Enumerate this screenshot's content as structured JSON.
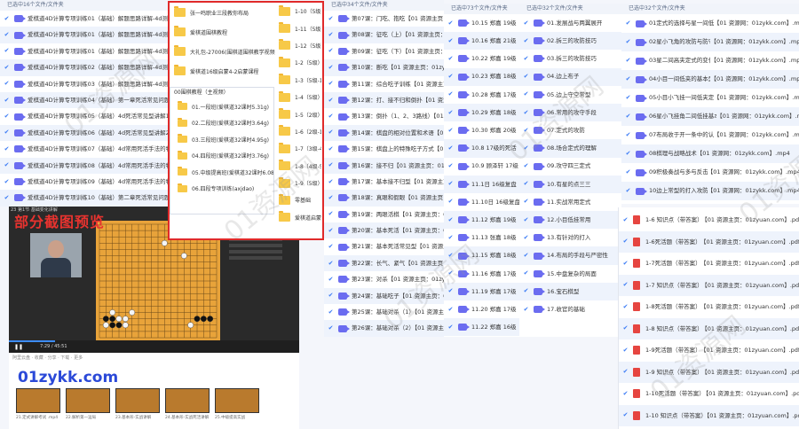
{
  "panel1": {
    "header": "已选中16个文件/文件夹",
    "rows": [
      "爱棋道4D计算专项训练01（基础）解题思路详解-4d测试题（1）",
      "爱棋道4D计算专项训练01（基础）解题思路详解-4d测试题（2）",
      "爱棋道4D计算专项训练01（基础）解题思路详解-4d测试题（3）",
      "爱棋道4D计算专项训练02（基础）解题思路详解-4d测试题（4）",
      "爱棋道4D计算专项训练03（基础）解题思路详解-4d测试题（5）",
      "爱棋道4D计算专项训练04（基础）第一章死活常见问题详解",
      "爱棋道4D计算专项训练05（基础）4d死活常见型讲解1『边上板",
      "爱棋道4D计算专项训练06（基础）4d死活常见型讲解2『边角死",
      "爱棋道4D计算专项训练07（基础）4d常用死活手法的特点和要",
      "爱棋道4D计算专项训练08（基础）4d常用死活手法的特点和要",
      "爱棋道4D计算专项训练09（基础）4d常用死活手法的特点和要",
      "爱棋道4D计算专项训练10（基础）第二章死活常见问题详解"
    ]
  },
  "redbox": {
    "top_items": [
      "张一鸣职业三段教你布局",
      "爱棋道围棋教程",
      "大礼包-27006(围棋道围棋教学视频",
      "爱棋道16级启蒙4-2启蒙课程"
    ],
    "right_items": [
      "1-10（5级）",
      "1-11（5级）",
      "1-12（5级）",
      "1-2（5级）",
      "1-3（5级-1级）",
      "1-4（5级）",
      "1-5（2级）",
      "1-6（2级-1级）",
      "1-7（3级-4级）",
      "1-8（4级-5级）",
      "1-9（5级）",
      "零基础",
      "爱棋道启蒙"
    ],
    "sub_title": "00围棋教程（主视频）",
    "sub_items": [
      "01.一段班(爱棋道32课时5.31g)",
      "02.二段班(爱棋道32课时3.64g)",
      "03.三段班(爱棋道32课时4.95g)",
      "04.四段班(爱棋道32课时3.76g)",
      "05.中级提高班(爱棋道32课时6.08G)",
      "06.四段专项训练(axjdao)"
    ]
  },
  "video": {
    "title": "23 第1节 基础变化讲解",
    "time": "7:29 / 45:51",
    "tools": "阿里云盘 · 收藏  · 分享  · 下载  · 更多",
    "thumbs": [
      "21.定式讲解考试 .mp4",
      "22.解析第一运局",
      "23.基本形-实战讲解",
      "24.基本形-实战死活讲解",
      "25.中级提高实战"
    ]
  },
  "preview_label": "部分截图预览",
  "site": "01zykk.com",
  "panel_mid": {
    "header": "已选中34个文件/文件夹",
    "rows": [
      "第07课：门吃、抱吃【01 资源主页：01zyuan.com】.mp4",
      "第08课：征吃（上）【01 资源主页：01zyuan.com】.mp4",
      "第09课：征吃（下）【01 资源主页：01zyuan.com】.mp4",
      "第10课：断吃【01 资源主页：01zyuan.com】.mp4",
      "第11课：综合吃子训练【01 资源主页：01zyuan.com】.mp4",
      "第12课：打、接不归和倒扑【01 资源主页：01zyuan.com】.mp4",
      "第13课：倒扑（1、2、3路线）【01 资源主页：01zyuan.com】.mp4",
      "第14课：棋盘的相对位置和术语【01 资源主页：01zyuan.com】.mp4",
      "第15课：棋盘上的特殊吃子方式【01 资源主页：01zyuan.com】.mp4",
      "第16课：接不归【01 资源主页：01zyuan.com】.mp4",
      "第17课：基本接不归型【01 资源主页：01zyuan.com】.mp4",
      "第18课：真眼和假眼【01 资源主页：01zyuan.com】.mp4",
      "第19课：两眼活棋【01 资源主页：01zyuan.com】.mp4",
      "第20课：基本死活【01 资源主页：01zyuan.com】.mp4",
      "第21课：基本死活常见型【01 资源主页：01zyuan.com】.mp4",
      "第22课：长气、紧气【01 资源主页：01zyuan.com】.mp4",
      "第23课：对杀【01 资源主页：01zyuan.com】.mp4",
      "第24课：基础吃子【01 资源主页：01zyuan.com】.mp4",
      "第25课：基础对杀（1）【01 资源主页：01zyuan.com】.mp4",
      "第26课：基础对杀（2）【01 资源主页：01zyuan.com】.mp4"
    ]
  },
  "panel_a": {
    "header": "已选中73个文件/文件夹",
    "rows": [
      "10.15 郑嘉 19级【01】",
      "10.16 郑嘉 21级【01】",
      "10.22 郑嘉 19级【01】",
      "10.23 郑嘉 18级【01】",
      "10.28 郑嘉 17级【01】",
      "10.29 郑嘉 18级【01】",
      "10.30 郑嘉 20级【01】",
      "10.8 17级的死活【01】",
      "10.9 顾泽轩 17级【01】",
      "11.1日 16级复盘【01】",
      "11.10日 16级复盘【01】",
      "11.12 郑嘉 19级【01】",
      "11.13 张嘉 18级【01】",
      "11.15 郑嘉 18级【01】",
      "11.16 郑嘉 17级【01】",
      "11.19 郑嘉 17级【01】",
      "11.20 郑嘉 17级【01】",
      "11.22 郑嘉 16级【01】"
    ]
  },
  "panel_b": {
    "header": "已选中32个文件/文件夹",
    "rows": [
      "01.发展战与两翼展开",
      "02.拆三的攻防技巧",
      "03.拆三的攻防技巧",
      "04.边上布子",
      "05.边上守空常型",
      "06.常用的攻守手段",
      "07.定式的攻防",
      "08.场合定式的理解",
      "09.攻守四三定式",
      "10.有星的点三三",
      "11.实战常用定式",
      "12.小目低挂常用",
      "13.有针对的打入",
      "14.布局的手段与严密性",
      "15.中盘复杂的局面",
      "16.宝石棋型",
      "17.收官的基础"
    ]
  },
  "panel_c": {
    "header": "已选中32个文件/文件夹",
    "rows": [
      "01定式的选择与星一间低夹",
      "02星小飞角的攻防与防守",
      "03星二间高夹定式的变化",
      "04小目一间低夹的基本型",
      "05小目小飞挂一间低夹定式",
      "06星小飞挂角二间低挂基本型",
      "07布局收于开一条中的认识",
      "08棋理与战略战术",
      "09积极奏战与多与反击",
      "10边上常型的打入攻防"
    ],
    "suffix": "【01 资源网：01zykk.com】.mp4"
  },
  "panel_pdf": {
    "rows": [
      "1-6 知识点（带答案）",
      "1-6死活题（带答案）",
      "1-7死活题（带答案）",
      "1-7 知识点（带答案）",
      "1-8死活题（带答案）",
      "1-8 知识点（带答案）",
      "1-9死活题（带答案）",
      "1-9 知识点（带答案）",
      "1-10死活题（带答案）",
      "1-10 知识点（带答案）"
    ],
    "suffix": "【01 资源主页：01zyuan.com】.pdf"
  },
  "watermark": [
    "01资源网",
    "01资源网",
    "01资源网",
    "01资源网",
    "01资源网",
    "01资源网"
  ],
  "colors": {
    "red": "#e02a2a",
    "video": "#6b6cf0",
    "folder": "#f7c948",
    "pdf": "#e64540",
    "site": "#2b49d8"
  }
}
